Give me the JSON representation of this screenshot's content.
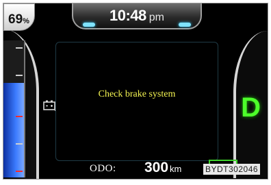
{
  "header": {
    "time": "10:48",
    "ampm": "pm"
  },
  "battery": {
    "percent": "69",
    "unit": "%",
    "level": 0.69
  },
  "display": {
    "message": "Check brake system"
  },
  "gear": {
    "current": "D",
    "color": "#4dff2a"
  },
  "odometer": {
    "label": "ODO:",
    "value": "300",
    "unit": "km"
  },
  "figure_code": "BYDT302046",
  "colors": {
    "alert_text": "#f5f552",
    "gauge_blue": "#3b7bff",
    "indicator_green": "#3dd12a"
  }
}
